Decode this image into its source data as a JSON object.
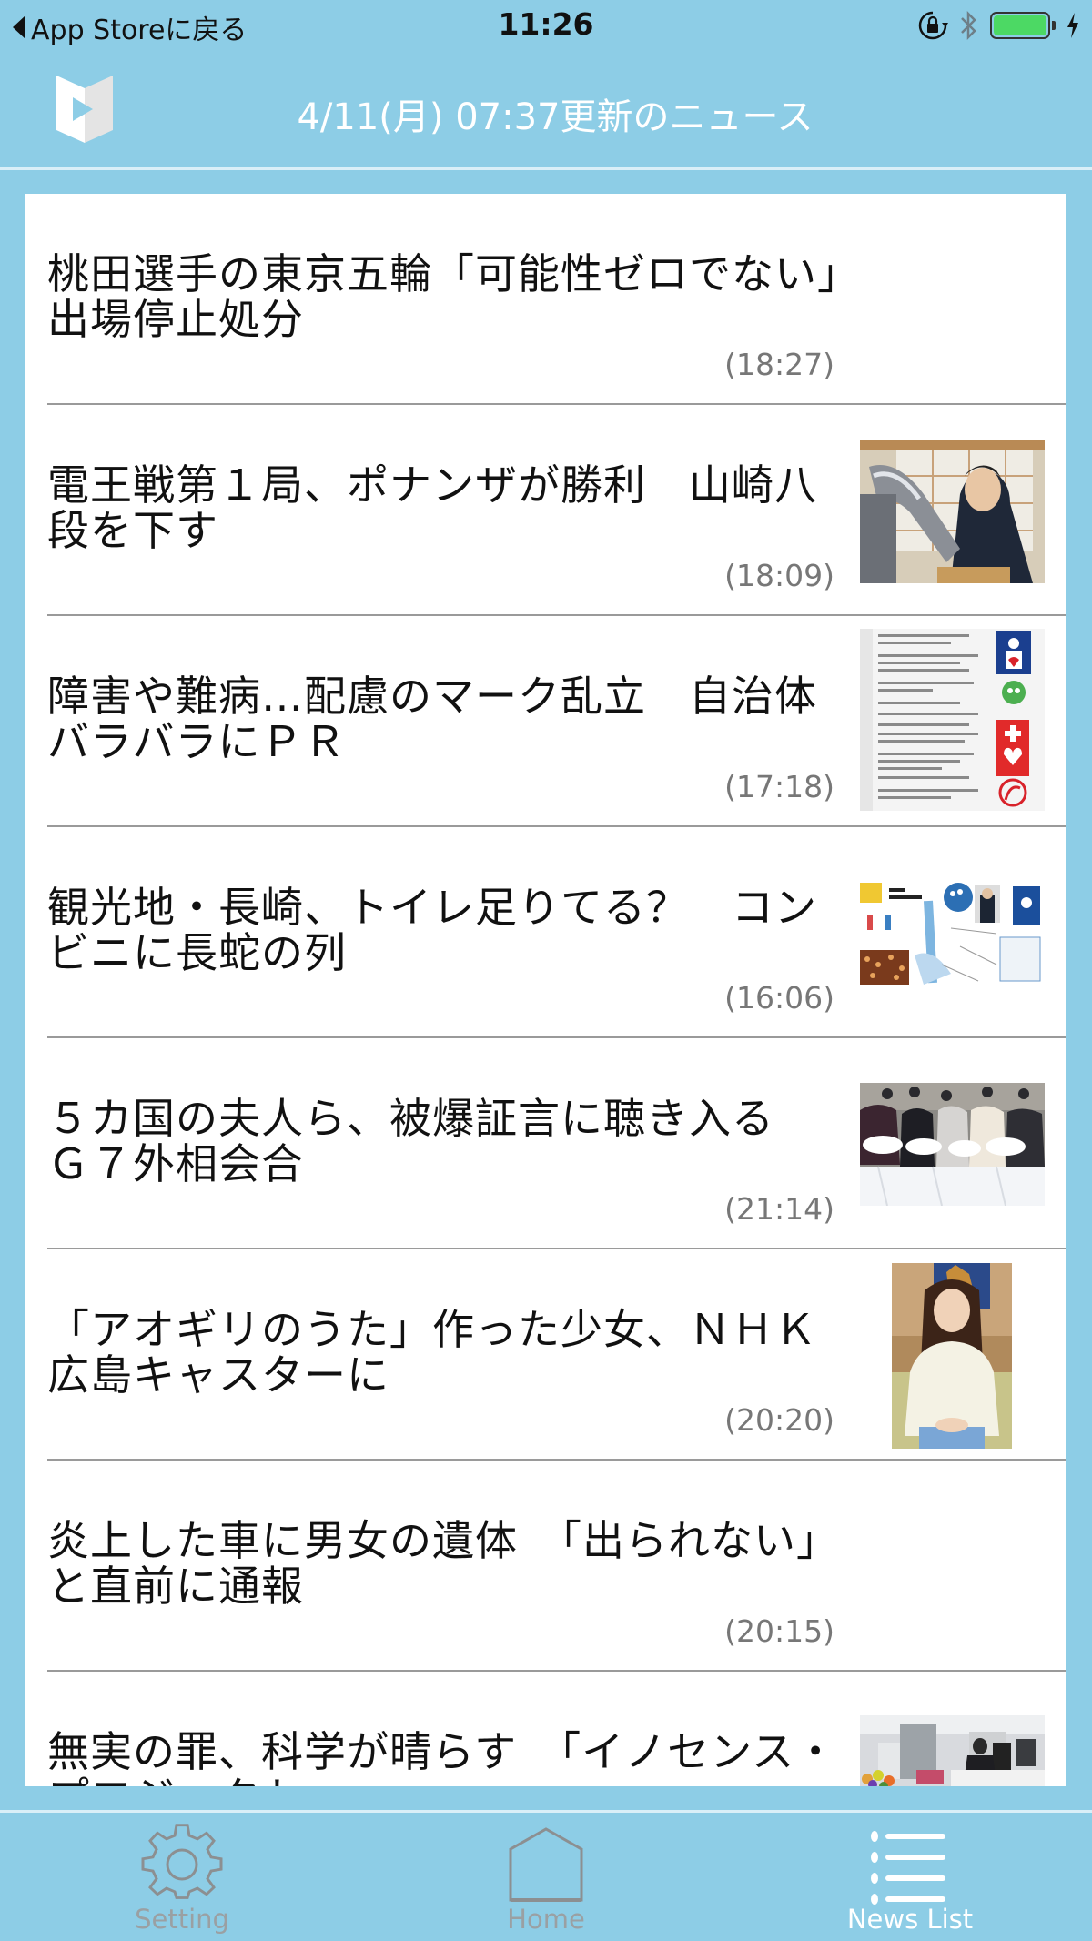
{
  "status_bar": {
    "back_label": "App Storeに戻る",
    "time": "11:26",
    "icons": [
      "rotation-lock-icon",
      "bluetooth-icon",
      "battery-icon",
      "charging-icon"
    ],
    "battery_level": 1.0,
    "battery_color": "#4cd964"
  },
  "header": {
    "logo": "app-logo-icon",
    "title": "4/11(月) 07:37更新のニュース"
  },
  "theme": {
    "background": "#8dcde6",
    "card": "#ffffff",
    "active_tab": "#ffffff",
    "inactive_tab": "#9aa0a3"
  },
  "news": [
    {
      "title": "桃田選手の東京五輪「可能性ゼロでない」　出場停止処分",
      "time": "(18:27)",
      "thumbnail": null
    },
    {
      "title": "電王戦第１局、ポナンザが勝利　山崎八段を下す",
      "time": "(18:09)",
      "thumbnail": "shogi-robot-arm-photo"
    },
    {
      "title": "障害や難病…配慮のマーク乱立　自治体バラバラにＰＲ",
      "time": "(17:18)",
      "thumbnail": "accessibility-marks-infographic"
    },
    {
      "title": "観光地・長崎、トイレ足りてる？　コンビニに長蛇の列",
      "time": "(16:06)",
      "thumbnail": "nagasaki-toilet-map-infographic"
    },
    {
      "title": "５カ国の夫人ら、被爆証言に聴き入る　Ｇ７外相会合",
      "time": "(21:14)",
      "thumbnail": "g7-spouses-flowers-photo"
    },
    {
      "title": "「アオギリのうた」作った少女、ＮＨＫ広島キャスターに",
      "time": "(20:20)",
      "thumbnail": "young-woman-portrait-photo"
    },
    {
      "title": "炎上した車に男女の遺体　「出られない」と直前に通報",
      "time": "(20:15)",
      "thumbnail": null
    },
    {
      "title": "無実の罪、科学が晴らす　「イノセンス・プロジェクト」",
      "time": "",
      "thumbnail": "office-lab-photo"
    }
  ],
  "tabbar": {
    "tabs": [
      {
        "label": "Setting",
        "icon": "gear-icon",
        "active": false
      },
      {
        "label": "Home",
        "icon": "home-icon",
        "active": false
      },
      {
        "label": "News List",
        "icon": "list-icon",
        "active": true
      }
    ]
  }
}
